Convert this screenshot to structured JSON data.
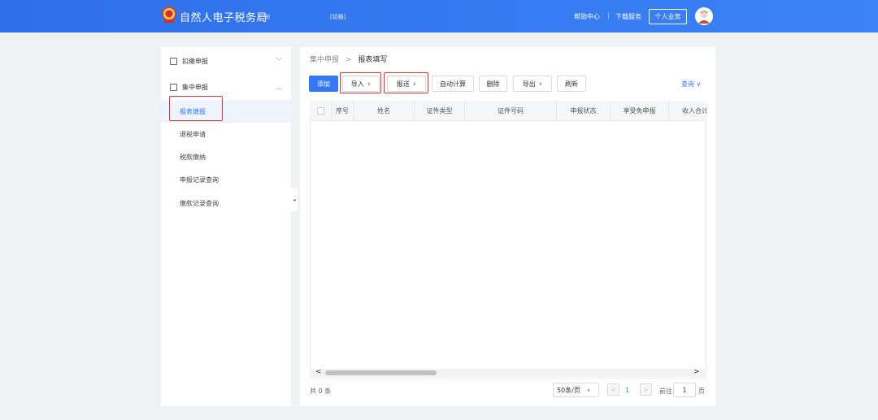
{
  "header": {
    "title": "自然人电子税务局",
    "city": "广州",
    "switch_label": "[切换]",
    "help_center": "帮助中心",
    "separator": "|",
    "download_service": "下载服务",
    "personal_business": "个人业务"
  },
  "sidebar": {
    "groups": [
      {
        "label": "扣缴申报",
        "chevron": "﹀"
      },
      {
        "label": "集中申报",
        "chevron": "︿"
      }
    ],
    "items": [
      {
        "label": "报表填报",
        "active": true
      },
      {
        "label": "退税申请"
      },
      {
        "label": "税款缴纳"
      },
      {
        "label": "申报记录查询"
      },
      {
        "label": "缴款记录查询"
      }
    ],
    "collapse_arrow": "◂"
  },
  "breadcrumb": {
    "parent": "集中申报",
    "separator": ">",
    "current": "报表填写"
  },
  "toolbar": {
    "add": "添加",
    "import": "导入",
    "submit": "报送",
    "auto_calc": "自动计算",
    "delete": "删除",
    "export": "导出",
    "refresh": "刷新",
    "query": "查询",
    "caret": "∨"
  },
  "table": {
    "columns": [
      "序号",
      "姓名",
      "证件类型",
      "证件号码",
      "申报状态",
      "享受免申报",
      "收入合计"
    ]
  },
  "scroll": {
    "left": "<",
    "right": ">"
  },
  "pagination": {
    "total": "共 0 条",
    "page_size": "50条/页",
    "prev": "<",
    "next": ">",
    "current_page": "1",
    "goto_label": "前往",
    "goto_value": "1",
    "goto_unit": "页"
  },
  "colors": {
    "primary": "#3478f6",
    "highlight_box": "#e5322d"
  }
}
